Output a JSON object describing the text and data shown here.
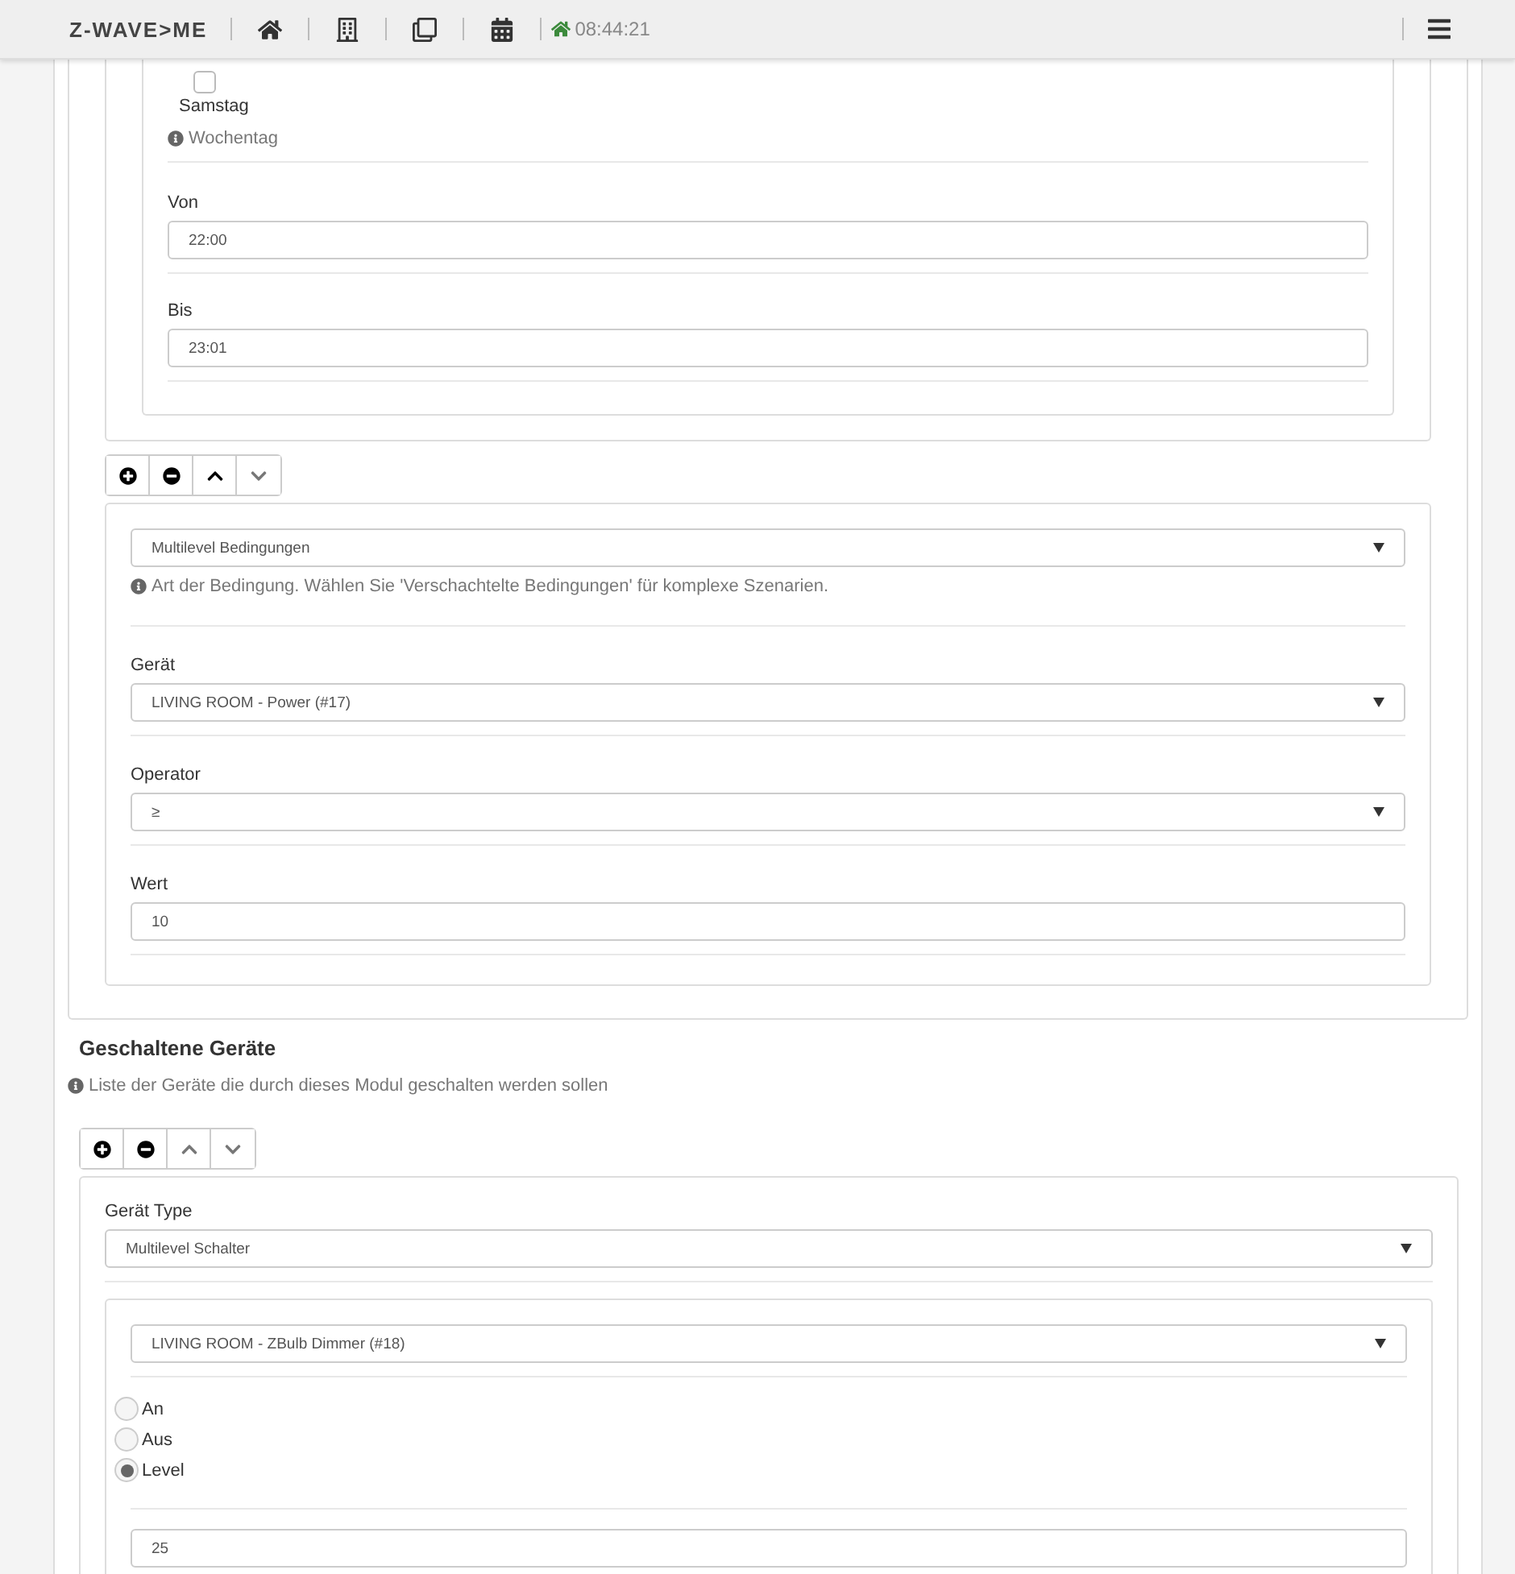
{
  "navbar": {
    "logo": "Z-WAVE>ME",
    "time": "08:44:21"
  },
  "weekday_field": {
    "days": [
      {
        "label": "Samstag",
        "checked": false
      }
    ],
    "help": "Wochentag"
  },
  "time_fields": [
    {
      "label": "Von",
      "value": "22:00"
    },
    {
      "label": "Bis",
      "value": "23:01"
    }
  ],
  "condition_toolbar": {
    "up_disabled": false,
    "down_disabled": true
  },
  "condition": {
    "type": "Multilevel Bedingungen",
    "help": "Art der Bedingung. Wählen Sie 'Verschachtelte Bedingungen' für komplexe Szenarien.",
    "fields": [
      {
        "label": "Gerät",
        "kind": "select",
        "value": "LIVING ROOM - Power (#17)"
      },
      {
        "label": "Operator",
        "kind": "select",
        "value": "≥"
      },
      {
        "label": "Wert",
        "kind": "input",
        "value": "10"
      }
    ]
  },
  "switched_devices": {
    "title": "Geschaltene Geräte",
    "help": "Liste der Geräte die durch dieses Modul geschalten werden sollen",
    "toolbar": {
      "up_disabled": true,
      "down_disabled": true
    },
    "device_type_label": "Gerät Type",
    "device_type": "Multilevel Schalter",
    "device": "LIVING ROOM - ZBulb Dimmer (#18)",
    "options": [
      {
        "label": "An",
        "selected": false
      },
      {
        "label": "Aus",
        "selected": false
      },
      {
        "label": "Level",
        "selected": true
      }
    ],
    "level_value": "25"
  }
}
